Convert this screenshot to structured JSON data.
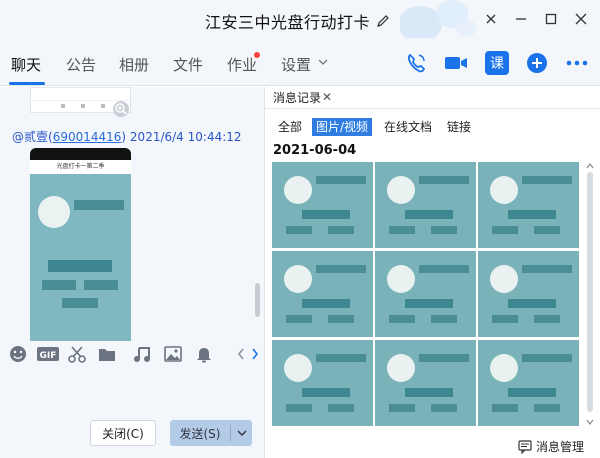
{
  "window": {
    "title": "江安三中光盘行动打卡"
  },
  "tabs": [
    {
      "label": "聊天"
    },
    {
      "label": "公告"
    },
    {
      "label": "相册"
    },
    {
      "label": "文件"
    },
    {
      "label": "作业"
    },
    {
      "label": "设置"
    }
  ],
  "toolbar_right": {
    "course_label": "课"
  },
  "chat": {
    "sender_name": "@贰壹",
    "sender_id": "690014416",
    "timestamp": "2021/6/4 10:44:12",
    "phone_header": "光盘打卡一第二季"
  },
  "compose": {
    "close_label": "关闭(C)",
    "send_label": "发送(S)"
  },
  "history": {
    "tab_label": "消息记录",
    "subtabs": [
      "全部",
      "图片/视频",
      "在线文档",
      "链接"
    ],
    "date": "2021-06-04",
    "manage_label": "消息管理"
  },
  "colors": {
    "accent": "#1a73e8",
    "thumb_bg": "#79b2b8",
    "send_button": "#b3cbe6"
  }
}
